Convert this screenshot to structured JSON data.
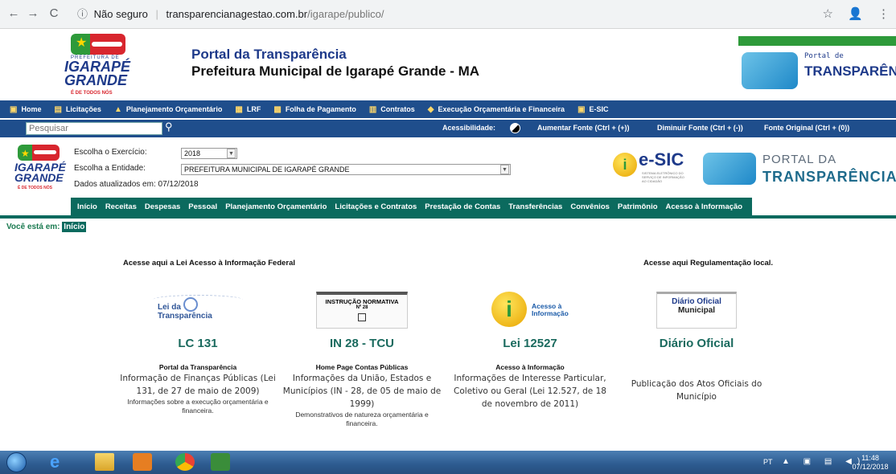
{
  "browser": {
    "back_icon": "←",
    "forward_icon": "→",
    "reload_icon": "C",
    "security_icon": "ⓘ",
    "security_text": "Não seguro",
    "url_host": "transparencianagestao.com.br",
    "url_path": "/igarape/publico/",
    "star_icon": "☆",
    "profile_icon": "👤",
    "menu_icon": "⋮"
  },
  "header": {
    "logo_small": "PREFEITURA DE",
    "logo_big_1": "IGARAPÉ",
    "logo_big_2": "GRANDE",
    "logo_tagline": "É DE TODOS NÓS",
    "title": "Portal da Transparência",
    "subtitle": "Prefeitura Municipal de Igarapé Grande - MA",
    "right_logo_small": "Portal de",
    "right_logo_big": "TRANSPARÊNCIA"
  },
  "top_menu": {
    "items": [
      {
        "icon": "▣",
        "label": "Home"
      },
      {
        "icon": "▤",
        "label": "Licitações"
      },
      {
        "icon": "▲",
        "label": "Planejamento Orçamentário"
      },
      {
        "icon": "▦",
        "label": "LRF"
      },
      {
        "icon": "▩",
        "label": "Folha de Pagamento"
      },
      {
        "icon": "▥",
        "label": "Contratos"
      },
      {
        "icon": "◆",
        "label": "Execução Orçamentária e Financeira"
      },
      {
        "icon": "▣",
        "label": "E-SIC"
      }
    ]
  },
  "search": {
    "placeholder": "Pesquisar",
    "accessibility_label": "Acessibilidade:",
    "increase_font": "Aumentar Fonte (Ctrl + (+))",
    "decrease_font": "Diminuir Fonte (Ctrl + (-))",
    "original_font": "Fonte Original (Ctrl + (0))"
  },
  "entity": {
    "year_label": "Escolha o Exercício:",
    "year_value": "2018",
    "entity_label": "Escolha a Entidade:",
    "entity_value": "PREFEITURA MUNICIPAL DE IGARAPÉ GRANDE",
    "updated_text": "Dados atualizados em: 07/12/2018",
    "esic_text": "e-SIC",
    "esic_sub": "SISTEMA ELETRÔNICO DO SERVIÇO DE INFORMAÇÃO AO CIDADÃO",
    "portal_line1": "PORTAL DA",
    "portal_line2": "TRANSPARÊNCIA"
  },
  "green_menu": {
    "items": [
      "Início",
      "Receitas",
      "Despesas",
      "Pessoal",
      "Planejamento Orçamentário",
      "Licitações e Contratos",
      "Prestação de Contas",
      "Transferências",
      "Convênios",
      "Patrimônio",
      "Acesso à Informação"
    ]
  },
  "breadcrumb": {
    "prefix": "Você está em:",
    "current": "Início"
  },
  "main": {
    "left_title": "Acesse aqui a Lei Acesso à Informação Federal",
    "right_title": "Acesse aqui Regulamentação local.",
    "cards": [
      {
        "img_line1": "Lei da",
        "img_line2": "Transparência",
        "heading": "LC 131",
        "bold": "Portal da Transparência",
        "text": "Informação de Finanças Públicas (Lei 131, de 27 de maio de 2009)",
        "small": "Informações sobre a execução orçamentária e financeira."
      },
      {
        "img_line1": "INSTRUÇÃO NORMATIVA",
        "img_line2": "Nº 28",
        "heading": "IN 28 - TCU",
        "bold": "Home Page Contas Públicas",
        "text": "Informações da União, Estados e Municípios (IN - 28, de 05 de maio de 1999)",
        "small": "Demonstrativos de natureza orçamentária e financeira."
      },
      {
        "img_line1": "Acesso à",
        "img_line2": "Informação",
        "heading": "Lei 12527",
        "bold": "Acesso à Informação",
        "text": "Informações de Interesse Particular, Coletivo ou Geral (Lei 12.527, de 18 de novembro de 2011)",
        "small": ""
      },
      {
        "img_line1": "Diário Oficial",
        "img_line2": "Municipal",
        "heading": "Diário Oficial",
        "bold": "",
        "text": "Publicação dos Atos Oficiais do Município",
        "small": ""
      }
    ]
  },
  "taskbar": {
    "lang": "PT",
    "tray_icons": "▲ ▣ ▤ ◀)",
    "time": "11:48",
    "date": "07/12/2018"
  },
  "colors": {
    "top_menu_bg": "#1f4e8c",
    "green_menu_bg": "#0b6a5e",
    "heading_green": "#1a6a5e",
    "title_blue": "#1e3a8a"
  }
}
